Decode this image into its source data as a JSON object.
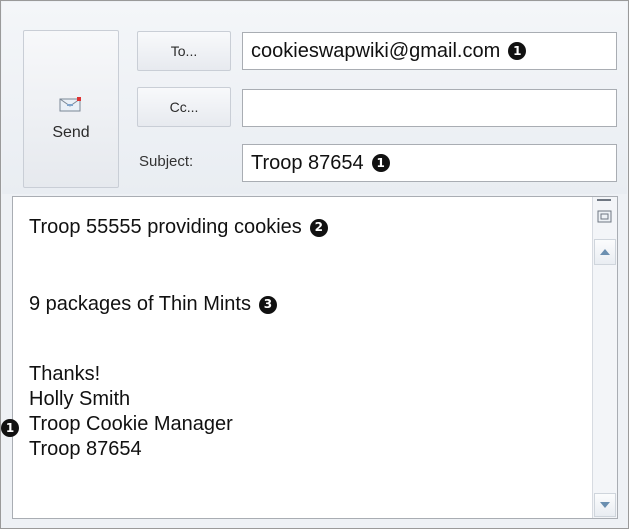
{
  "compose": {
    "send_label": "Send",
    "to_button": "To...",
    "cc_button": "Cc...",
    "subject_label": "Subject:",
    "to_value": "cookieswapwiki@gmail.com",
    "cc_value": "",
    "subject_value": "Troop 87654"
  },
  "body": {
    "line1": "Troop 55555 providing cookies",
    "line2": "9 packages of Thin Mints",
    "line3": "Thanks!",
    "line4": "Holly Smith",
    "line5": "Troop Cookie Manager",
    "line6": "Troop 87654"
  },
  "badges": {
    "to": "1",
    "subject": "1",
    "line1": "2",
    "line2": "3",
    "signature": "1"
  },
  "icons": {
    "send": "envelope-icon",
    "scroll_up": "triangle-up-icon",
    "scroll_down": "triangle-down-icon",
    "scroll_small": "card-icon"
  },
  "colors": {
    "badge": "#111111",
    "field_border": "#a9adb3",
    "chrome": "#eef1f5"
  }
}
